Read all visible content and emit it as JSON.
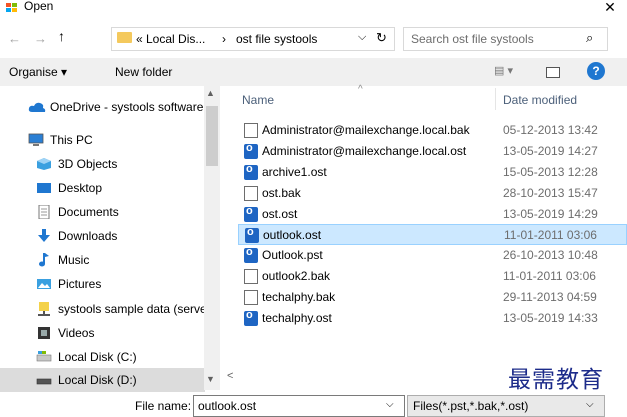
{
  "window": {
    "title": "Open",
    "close_label": "✕"
  },
  "nav_buttons": {
    "back": "←",
    "forward": "→",
    "up": "↑"
  },
  "address": {
    "crumb1": "« Local Dis...",
    "sep": "›",
    "crumb2": "ost file systools",
    "dropdown": "⌵",
    "refresh": "↻"
  },
  "search": {
    "placeholder": "Search ost file systools",
    "icon": "⌕"
  },
  "toolbar": {
    "organise": "Organise ▾",
    "new_folder": "New folder",
    "view": "▤ ▾",
    "help": "?"
  },
  "sidebar": {
    "items": [
      {
        "label": "OneDrive - systools software",
        "icon": "cloud-icon",
        "color": "#1f77d0"
      },
      {
        "label": "This PC",
        "icon": "computer-icon",
        "color": "#2a7fd4"
      },
      {
        "label": "3D Objects",
        "icon": "cube-icon",
        "color": "#3aa0e0"
      },
      {
        "label": "Desktop",
        "icon": "desktop-icon",
        "color": "#1f77d0"
      },
      {
        "label": "Documents",
        "icon": "document-icon",
        "color": "#888888"
      },
      {
        "label": "Downloads",
        "icon": "download-icon",
        "color": "#1f77d0"
      },
      {
        "label": "Music",
        "icon": "music-icon",
        "color": "#1f77d0"
      },
      {
        "label": "Pictures",
        "icon": "pictures-icon",
        "color": "#3aa0e0"
      },
      {
        "label": "systools sample data (serve",
        "icon": "network-drive-icon",
        "color": "#d6b02a"
      },
      {
        "label": "Videos",
        "icon": "video-icon",
        "color": "#333333"
      },
      {
        "label": "Local Disk (C:)",
        "icon": "drive-icon",
        "color": "#3aa0e0"
      },
      {
        "label": "Local Disk (D:)",
        "icon": "drive-icon",
        "color": "#555555"
      }
    ],
    "scroll_up": "▲",
    "scroll_down": "▼"
  },
  "filelist": {
    "columns": {
      "name": "Name",
      "date": "Date modified",
      "sort_indicator": "^"
    },
    "files": [
      {
        "name": "Administrator@mailexchange.local.bak",
        "date": "05-12-2013 13:42",
        "type": "doc"
      },
      {
        "name": "Administrator@mailexchange.local.ost",
        "date": "13-05-2019 14:27",
        "type": "outlook"
      },
      {
        "name": "archive1.ost",
        "date": "15-05-2013 12:28",
        "type": "outlook"
      },
      {
        "name": "ost.bak",
        "date": "28-10-2013 15:47",
        "type": "doc"
      },
      {
        "name": "ost.ost",
        "date": "13-05-2019 14:29",
        "type": "outlook"
      },
      {
        "name": "outlook.ost",
        "date": "11-01-2011 03:06",
        "type": "outlook",
        "selected": true
      },
      {
        "name": "Outlook.pst",
        "date": "26-10-2013 10:48",
        "type": "outlook"
      },
      {
        "name": "outlook2.bak",
        "date": "11-01-2011 03:06",
        "type": "doc"
      },
      {
        "name": "techalphy.bak",
        "date": "29-11-2013 04:59",
        "type": "doc"
      },
      {
        "name": "techalphy.ost",
        "date": "13-05-2019 14:33",
        "type": "outlook"
      }
    ],
    "hscroll_left": "<"
  },
  "bottom": {
    "filename_label": "File name:",
    "filename_value": "outlook.ost",
    "filter_value": "Files(*.pst,*.bak,*.ost)",
    "dropdown": "⌵"
  },
  "watermark": "最需教育",
  "colors": {
    "accent": "#1f77d0",
    "selected_row": "#cce8ff",
    "header_text": "#4c607a"
  }
}
